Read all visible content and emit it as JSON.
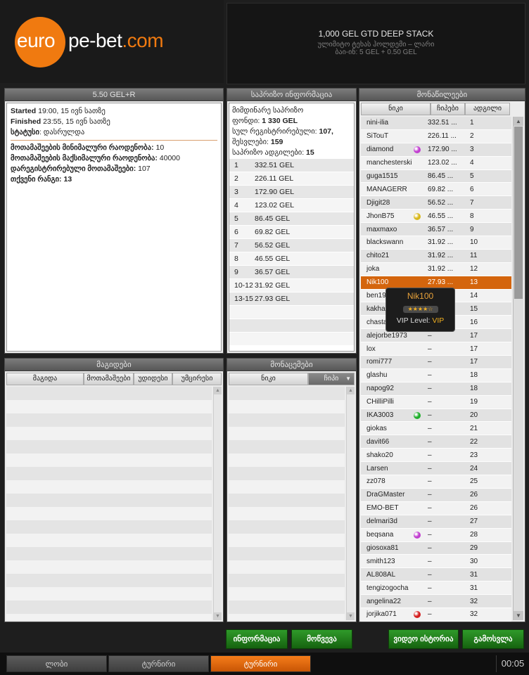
{
  "logo": {
    "part1": "euro",
    "part2": "pe-bet",
    "part3": ".com"
  },
  "banner": {
    "title": "1,000 GEL GTD DEEP STACK",
    "line2": "ულიმიტო ტეხას ჰოლდემი – ლარი",
    "line3": "ბაი-ინ: 5 GEL + 0.50 GEL"
  },
  "tourney_panel": {
    "title": "5.50 GEL+R",
    "started_label": "Started",
    "started_value": " 19:00, 15 ივნ სათზე",
    "finished_label": "Finished",
    "finished_value": " 23:55, 15 ივნ სათზე",
    "status_label": "სტატუსი",
    "status_value": ": დასრულდა",
    "min_label": "მოთამაშეების მინიმალური რაოდენობა:",
    "min_value": " 10",
    "max_label": "მოთამაშეების მაქსიმალური რაოდენობა:",
    "max_value": " 40000",
    "reg_label": "დარეგისტრირებული მოთამაშეები:",
    "reg_value": " 107",
    "rank_label": "თქვენი რანგი:",
    "rank_value": " 13"
  },
  "prize_panel": {
    "title": "საპრიზო ინფორმაცია",
    "line1": "მიმდინარე საპრიზო",
    "fund_label": "ფონდი:",
    "fund_value": " 1 330 GEL",
    "total_label": "სულ რეგისტრირებული:",
    "total_value": " 107,",
    "entries_label": "შესვლები:",
    "entries_value": " 159",
    "places_label": "საპრიზო ადგილები:",
    "places_value": " 15",
    "rows": [
      {
        "place": "1",
        "amount": "332.51 GEL"
      },
      {
        "place": "2",
        "amount": "226.11 GEL"
      },
      {
        "place": "3",
        "amount": "172.90 GEL"
      },
      {
        "place": "4",
        "amount": "123.02 GEL"
      },
      {
        "place": "5",
        "amount": "86.45 GEL"
      },
      {
        "place": "6",
        "amount": "69.82 GEL"
      },
      {
        "place": "7",
        "amount": "56.52 GEL"
      },
      {
        "place": "8",
        "amount": "46.55 GEL"
      },
      {
        "place": "9",
        "amount": "36.57 GEL"
      },
      {
        "place": "10-12",
        "amount": "31.92 GEL"
      },
      {
        "place": "13-15",
        "amount": "27.93 GEL"
      }
    ]
  },
  "players_panel": {
    "title": "მონაწილეები",
    "col_nick": "ნიკი",
    "col_chips": "ჩიპები",
    "col_place": "ადგილი",
    "rows": [
      {
        "nick": "nini-ilia",
        "chips": "332.51 ...",
        "place": "1",
        "dot": ""
      },
      {
        "nick": "SiTouT",
        "chips": "226.11 ...",
        "place": "2",
        "dot": ""
      },
      {
        "nick": "diamond",
        "chips": "172.90 ...",
        "place": "3",
        "dot": "#c13fd0"
      },
      {
        "nick": "manchesterski",
        "chips": "123.02 ...",
        "place": "4",
        "dot": ""
      },
      {
        "nick": "guga1515",
        "chips": "86.45 ...",
        "place": "5",
        "dot": ""
      },
      {
        "nick": "MANAGERR",
        "chips": "69.82 ...",
        "place": "6",
        "dot": ""
      },
      {
        "nick": "Djigit28",
        "chips": "56.52 ...",
        "place": "7",
        "dot": ""
      },
      {
        "nick": "JhonB75",
        "chips": "46.55 ...",
        "place": "8",
        "dot": "#d8b81c"
      },
      {
        "nick": "maxmaxo",
        "chips": "36.57 ...",
        "place": "9",
        "dot": ""
      },
      {
        "nick": "blackswann",
        "chips": "31.92 ...",
        "place": "10",
        "dot": ""
      },
      {
        "nick": "chito21",
        "chips": "31.92 ...",
        "place": "11",
        "dot": ""
      },
      {
        "nick": "joka",
        "chips": "31.92 ...",
        "place": "12",
        "dot": ""
      },
      {
        "nick": "Nik100",
        "chips": "27.93 ...",
        "place": "13",
        "dot": ""
      },
      {
        "nick": "ben19",
        "chips": "",
        "place": "14",
        "dot": ""
      },
      {
        "nick": "kakha",
        "chips": "",
        "place": "15",
        "dot": ""
      },
      {
        "nick": "chasta",
        "chips": "",
        "place": "16",
        "dot": ""
      },
      {
        "nick": "alejorbe1973",
        "chips": "–",
        "place": "17",
        "dot": ""
      },
      {
        "nick": "lox",
        "chips": "–",
        "place": "17",
        "dot": ""
      },
      {
        "nick": "romi777",
        "chips": "–",
        "place": "17",
        "dot": ""
      },
      {
        "nick": "glashu",
        "chips": "–",
        "place": "18",
        "dot": ""
      },
      {
        "nick": "napog92",
        "chips": "–",
        "place": "18",
        "dot": ""
      },
      {
        "nick": "CHilliPilli",
        "chips": "–",
        "place": "19",
        "dot": ""
      },
      {
        "nick": "IKA3003",
        "chips": "–",
        "place": "20",
        "dot": "#1fae2b"
      },
      {
        "nick": "giokas",
        "chips": "–",
        "place": "21",
        "dot": ""
      },
      {
        "nick": "davit66",
        "chips": "–",
        "place": "22",
        "dot": ""
      },
      {
        "nick": "shako20",
        "chips": "–",
        "place": "23",
        "dot": ""
      },
      {
        "nick": "Larsen",
        "chips": "–",
        "place": "24",
        "dot": ""
      },
      {
        "nick": "zz078",
        "chips": "–",
        "place": "25",
        "dot": ""
      },
      {
        "nick": "DraGMaster",
        "chips": "–",
        "place": "26",
        "dot": ""
      },
      {
        "nick": "EMO-BET",
        "chips": "–",
        "place": "26",
        "dot": ""
      },
      {
        "nick": "delmari3d",
        "chips": "–",
        "place": "27",
        "dot": ""
      },
      {
        "nick": "beqsana",
        "chips": "–",
        "place": "28",
        "dot": "#c13fd0"
      },
      {
        "nick": "giosoxa81",
        "chips": "–",
        "place": "29",
        "dot": ""
      },
      {
        "nick": "smith123",
        "chips": "–",
        "place": "30",
        "dot": ""
      },
      {
        "nick": "AL808AL",
        "chips": "–",
        "place": "31",
        "dot": ""
      },
      {
        "nick": "tengizogocha",
        "chips": "–",
        "place": "31",
        "dot": ""
      },
      {
        "nick": "angelina22",
        "chips": "–",
        "place": "32",
        "dot": ""
      },
      {
        "nick": "jorjika071",
        "chips": "–",
        "place": "32",
        "dot": "#d41e1e"
      }
    ],
    "selected_index": 12
  },
  "tooltip": {
    "name": "Nik100",
    "stars": "★★★★☆",
    "vip_label": "VIP Level:",
    "vip_value": "VIP"
  },
  "tables_panel": {
    "title": "მაგიდები",
    "cols": [
      "მაგიდა",
      "მოთამაშეები",
      "უდიდესი",
      "უმცირესი"
    ]
  },
  "participants_panel": {
    "title": "მონაცემები",
    "col_nick": "ნიკი",
    "col_chips": "ჩიპი"
  },
  "buttons": {
    "info": "ინფორმაცია",
    "register": "მოწვევა",
    "history": "ვიდეო ისტორია",
    "exit": "გამოსვლა"
  },
  "tabs": [
    {
      "label": "ლობი",
      "active": false
    },
    {
      "label": "ტურნირი",
      "active": false
    },
    {
      "label": "ტურნირი",
      "active": true
    }
  ],
  "clock": "00:05"
}
